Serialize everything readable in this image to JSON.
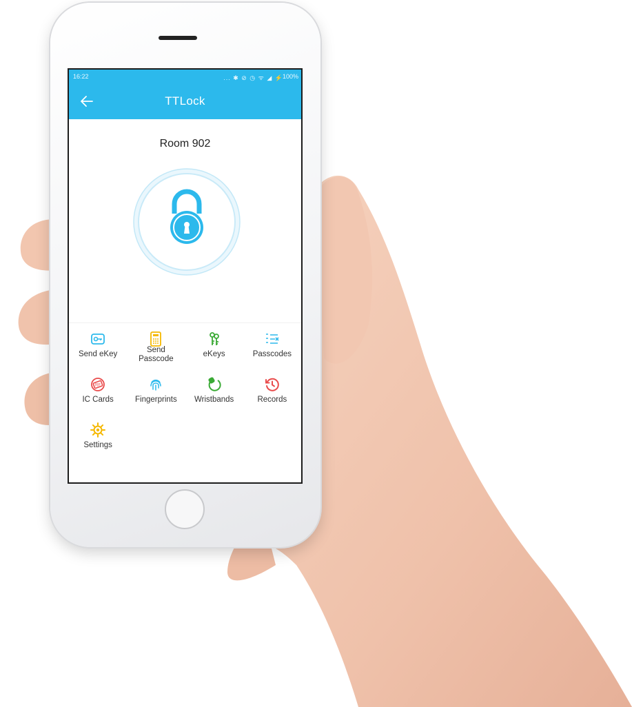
{
  "status_bar": {
    "time": "16:22",
    "icons": "... ✱ ⊘ ◷ ᯤ ◢ ⚡",
    "battery": "100%"
  },
  "app_bar": {
    "title": "TTLock",
    "back_icon": "arrow-left-icon"
  },
  "lock": {
    "room_name": "Room 902",
    "icon": "padlock-icon",
    "accent_color": "#2cb9ec"
  },
  "features": [
    {
      "label": "Send eKey",
      "icon": "send-ekey-icon",
      "color": "#2cb9ec"
    },
    {
      "label": "Send Passcode",
      "icon": "keypad-icon",
      "color": "#f5b800"
    },
    {
      "label": "eKeys",
      "icon": "keys-icon",
      "color": "#3aaa35"
    },
    {
      "label": "Passcodes",
      "icon": "passcode-list-icon",
      "color": "#2cb9ec"
    },
    {
      "label": "IC Cards",
      "icon": "rf-card-icon",
      "color": "#e94b4b"
    },
    {
      "label": "Fingerprints",
      "icon": "fingerprint-icon",
      "color": "#2cb9ec"
    },
    {
      "label": "Wristbands",
      "icon": "wristband-icon",
      "color": "#3aaa35"
    },
    {
      "label": "Records",
      "icon": "history-icon",
      "color": "#e94b4b"
    },
    {
      "label": "Settings",
      "icon": "gear-icon",
      "color": "#f5b800"
    }
  ]
}
